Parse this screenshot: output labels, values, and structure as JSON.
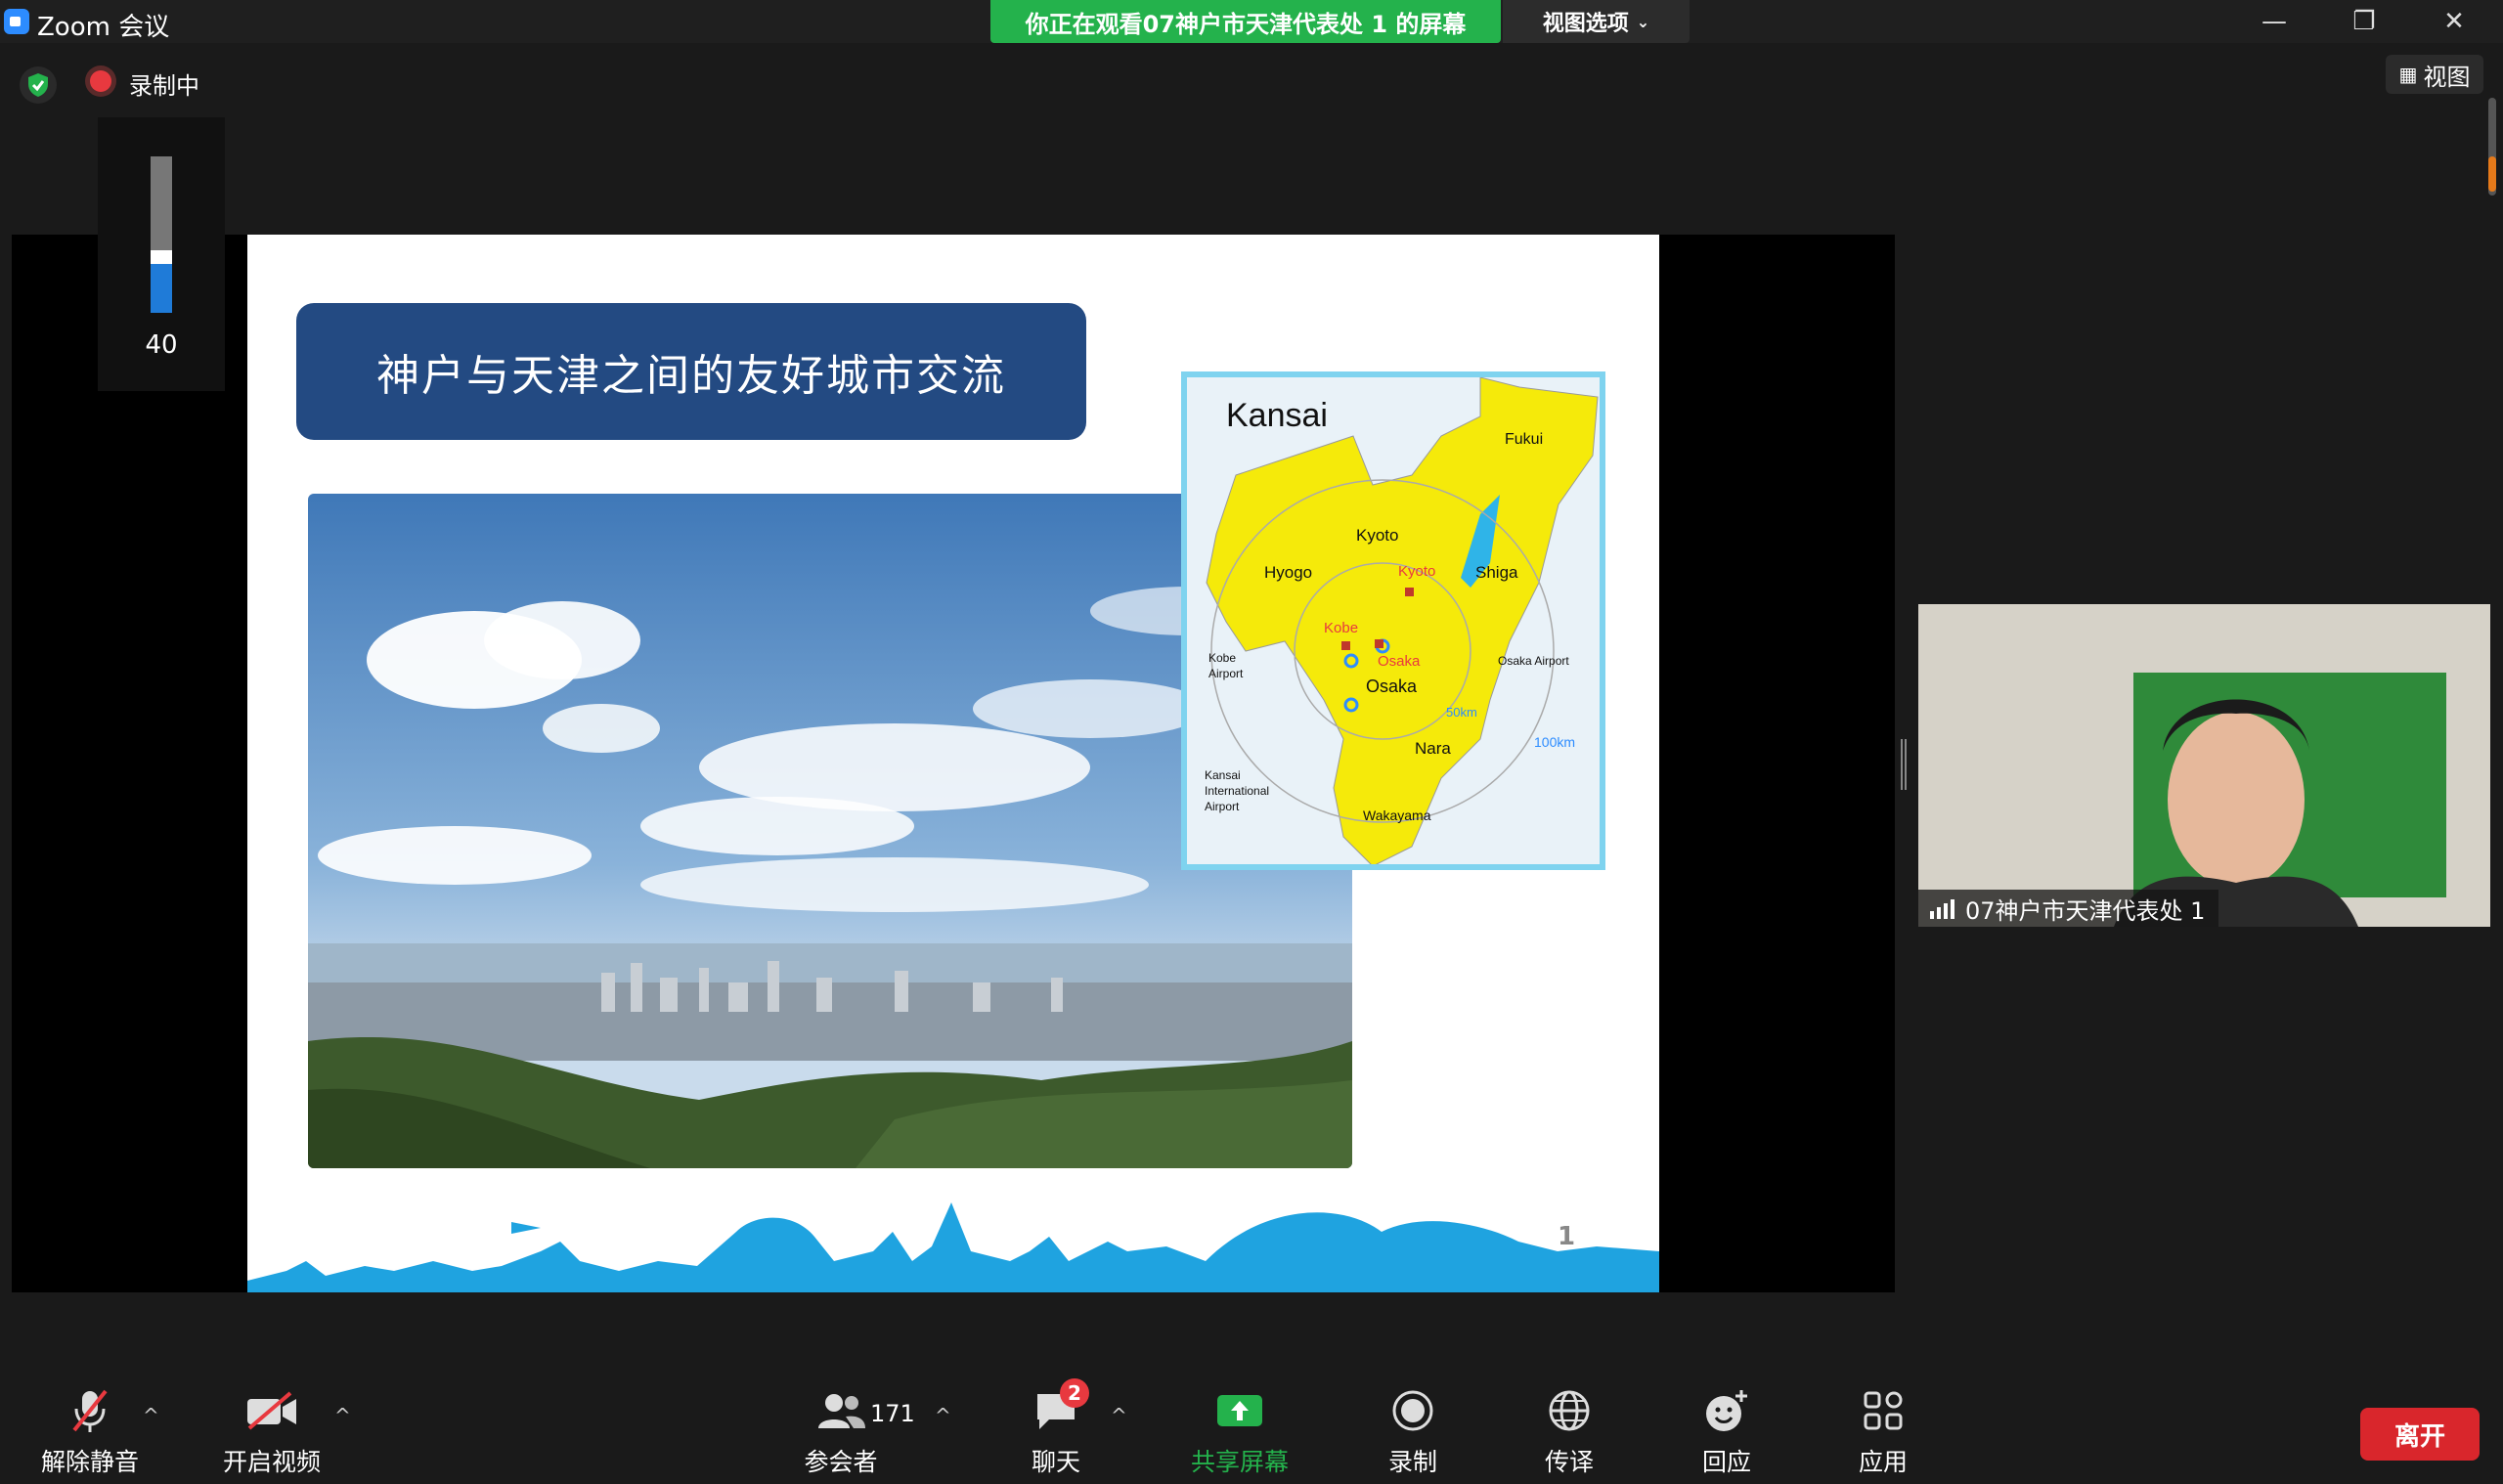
{
  "titlebar": {
    "title": "Zoom 会议",
    "banner": "你正在观看07神户市天津代表处 1 的屏幕",
    "view_options": "视图选项",
    "minimize": "—",
    "restore": "❐",
    "close": "✕"
  },
  "status": {
    "recording_label": "录制中",
    "view_label": "视图",
    "volume_value": "40",
    "volume_level": 0.4
  },
  "slide": {
    "title": "神户与天津之间的友好城市交流",
    "page_number": "1",
    "map": {
      "title": "Kansai",
      "labels": {
        "fukui": "Fukui",
        "kyoto_pref": "Kyoto",
        "hyogo": "Hyogo",
        "kyoto_city": "Kyoto",
        "shiga": "Shiga",
        "kobe": "Kobe",
        "osaka_city": "Osaka",
        "kobe_airport_1": "Kobe",
        "kobe_airport_2": "Airport",
        "osaka_airport": "Osaka Airport",
        "osaka_pref": "Osaka",
        "r50": "50km",
        "nara": "Nara",
        "r100": "100km",
        "kix_1": "Kansai",
        "kix_2": "International",
        "kix_3": "Airport",
        "wakayama": "Wakayama"
      }
    }
  },
  "participant": {
    "name": "07神户市天津代表处 1"
  },
  "toolbar": {
    "unmute": "解除静音",
    "start_video": "开启视频",
    "participants": "参会者",
    "participant_count": "171",
    "chat": "聊天",
    "chat_badge": "2",
    "share": "共享屏幕",
    "record": "录制",
    "interpret": "传译",
    "reactions": "回应",
    "apps": "应用",
    "leave": "离开",
    "caret": "^"
  },
  "colors": {
    "banner": "#24b24c",
    "leave": "#d9262c",
    "share_icon": "#24b24c",
    "slide_title_bg": "#234a82",
    "map_yellow": "#f5ea0a"
  }
}
